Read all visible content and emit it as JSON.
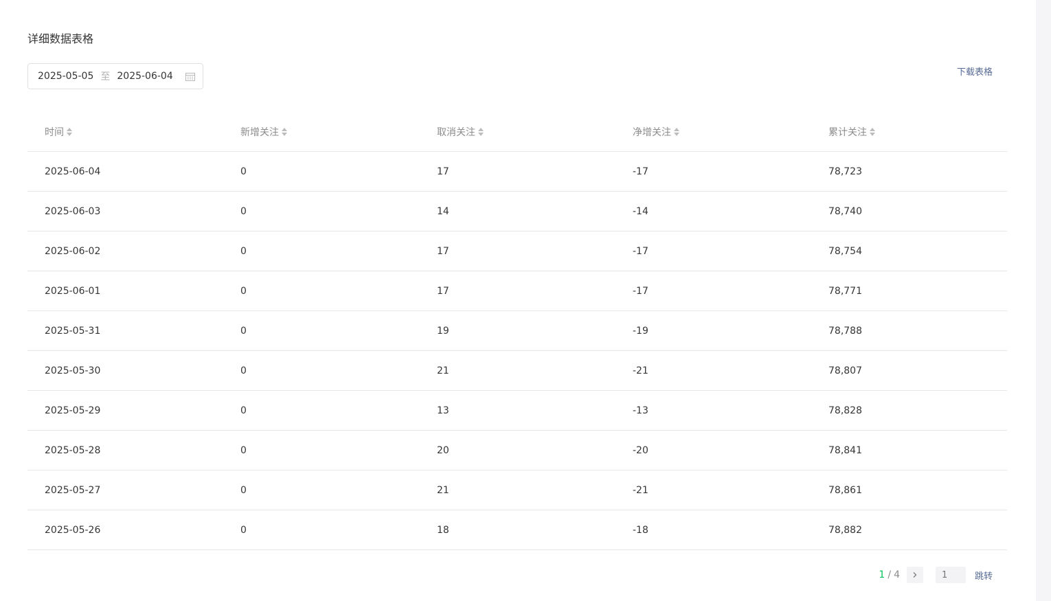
{
  "section": {
    "title": "详细数据表格",
    "download_label": "下载表格"
  },
  "date_range": {
    "start": "2025-05-05",
    "separator": "至",
    "end": "2025-06-04"
  },
  "table": {
    "columns": [
      "时间",
      "新增关注",
      "取消关注",
      "净增关注",
      "累计关注"
    ],
    "rows": [
      [
        "2025-06-04",
        "0",
        "17",
        "-17",
        "78,723"
      ],
      [
        "2025-06-03",
        "0",
        "14",
        "-14",
        "78,740"
      ],
      [
        "2025-06-02",
        "0",
        "17",
        "-17",
        "78,754"
      ],
      [
        "2025-06-01",
        "0",
        "17",
        "-17",
        "78,771"
      ],
      [
        "2025-05-31",
        "0",
        "19",
        "-19",
        "78,788"
      ],
      [
        "2025-05-30",
        "0",
        "21",
        "-21",
        "78,807"
      ],
      [
        "2025-05-29",
        "0",
        "13",
        "-13",
        "78,828"
      ],
      [
        "2025-05-28",
        "0",
        "20",
        "-20",
        "78,841"
      ],
      [
        "2025-05-27",
        "0",
        "21",
        "-21",
        "78,861"
      ],
      [
        "2025-05-26",
        "0",
        "18",
        "-18",
        "78,882"
      ]
    ]
  },
  "pagination": {
    "current": "1",
    "separator": "/",
    "total": "4",
    "input_placeholder": "1",
    "jump_label": "跳转"
  },
  "icons": {
    "calendar": "calendar-icon",
    "sort": "sort-icon",
    "next": "chevron-right-icon"
  },
  "colors": {
    "accent_green": "#07c160",
    "link_blue": "#576b95",
    "header_gray": "#8c8c8c",
    "divider": "#e7e7eb"
  }
}
